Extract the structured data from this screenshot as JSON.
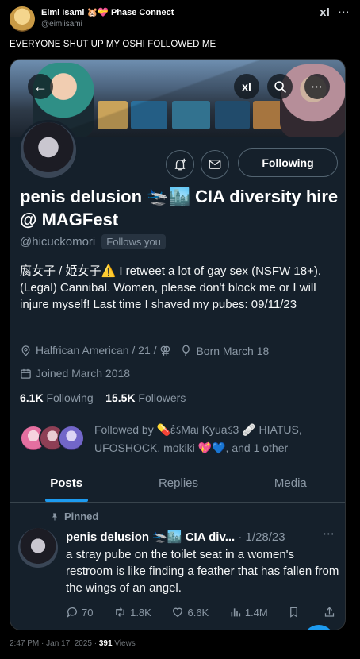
{
  "outer_tweet": {
    "name": "Eimi Isami",
    "name_emoji": "🐹💝",
    "affiliation": "Phase Connect",
    "handle": "@eimiisami",
    "grok_label": "xl",
    "more": "⋯",
    "text": "EVERYONE SHUT UP MY OSHI FOLLOWED ME"
  },
  "profile": {
    "back": "←",
    "grok_label": "xl",
    "search": "⌕",
    "more": "⋯",
    "following_button": "Following",
    "display_name": "penis delusion 🛬🏙️ CIA diversity hire @ MAGFest",
    "handle": "@hicuckomori",
    "follows_you": "Follows you",
    "bio": "腐女子 / 姫女子⚠️ I retweet a lot of gay sex (NSFW 18+). (Legal) Cannibal. Women, please don't block me or I will injure myself! Last time I shaved my pubes: 09/11/23",
    "location": "Halfrican American / 21 / ⚢",
    "birthday": "Born March 18",
    "joined": "Joined March 2018",
    "following_count": "6.1K",
    "following_label": "Following",
    "followers_count": "15.5K",
    "followers_label": "Followers",
    "followed_by": "Followed by 💊ἐઽMai Kyuaઽ3 🩹 HIATUS, UFOSHOCK, mokiki 💖💙, and 1 other"
  },
  "tabs": [
    {
      "label": "Posts",
      "active": true
    },
    {
      "label": "Replies",
      "active": false
    },
    {
      "label": "Media",
      "active": false
    }
  ],
  "pinned_post": {
    "pinned_label": "Pinned",
    "author": "penis delusion 🛬🏙️ CIA div...",
    "date": "· 1/28/23",
    "more": "⋯",
    "text": "a stray pube on the toilet seat in a women's restroom is like finding a feather that has fallen from the wings of an angel.",
    "replies": "70",
    "reposts": "1.8K",
    "likes": "6.6K",
    "views": "1.4M"
  },
  "footer": {
    "time": "2:47 PM · Jan 17, 2025 · ",
    "views_count": "391",
    "views_label": " Views"
  },
  "colors": {
    "background": "#000000",
    "card": "#15202b",
    "accent": "#1d9bf0",
    "muted_text": "#8b98a5"
  }
}
